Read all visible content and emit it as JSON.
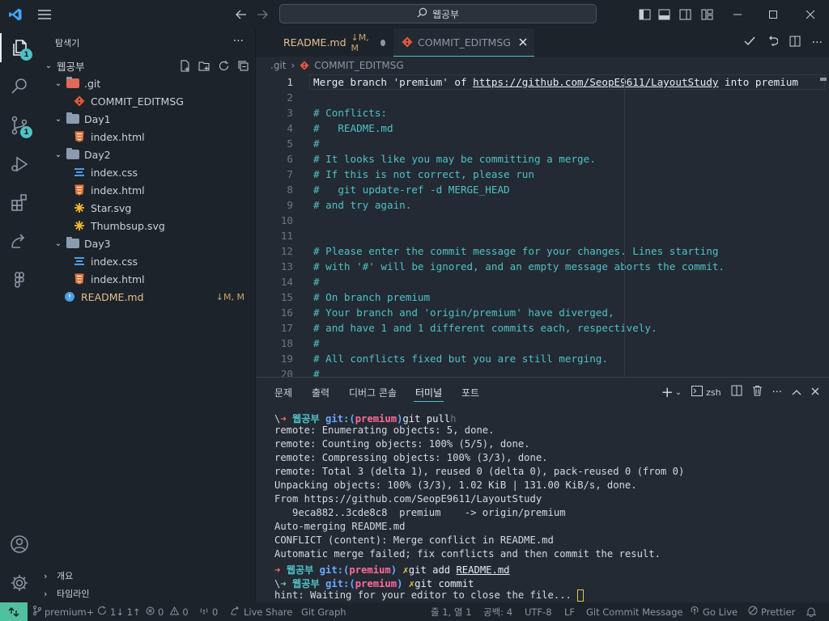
{
  "titlebar": {
    "search_text": "웹공부"
  },
  "activity": {
    "explorer_badge": "1",
    "scm_badge": "1"
  },
  "sidebar": {
    "title": "탐색기",
    "more": "···",
    "workspace": "웹공부",
    "tree": [
      {
        "label": ".git",
        "indent": 1,
        "kind": "folder-git"
      },
      {
        "label": "COMMIT_EDITMSG",
        "indent": 2,
        "kind": "git"
      },
      {
        "label": "Day1",
        "indent": 1,
        "kind": "folder"
      },
      {
        "label": "index.html",
        "indent": 2,
        "kind": "html"
      },
      {
        "label": "Day2",
        "indent": 1,
        "kind": "folder"
      },
      {
        "label": "index.css",
        "indent": 2,
        "kind": "css"
      },
      {
        "label": "index.html",
        "indent": 2,
        "kind": "html"
      },
      {
        "label": "Star.svg",
        "indent": 2,
        "kind": "svg"
      },
      {
        "label": "Thumbsup.svg",
        "indent": 2,
        "kind": "svg"
      },
      {
        "label": "Day3",
        "indent": 1,
        "kind": "folder"
      },
      {
        "label": "index.css",
        "indent": 2,
        "kind": "css"
      },
      {
        "label": "index.html",
        "indent": 2,
        "kind": "html"
      },
      {
        "label": "README.md",
        "indent": 1,
        "kind": "md"
      }
    ],
    "readme_badge": "↓M, M",
    "outline_label": "개요",
    "timeline_label": "타임라인"
  },
  "tabs": [
    {
      "label": "README.md",
      "badge": "↓M, M",
      "active": false
    },
    {
      "label": "COMMIT_EDITMSG",
      "active": true
    }
  ],
  "breadcrumb": {
    "folder": ".git",
    "file": "COMMIT_EDITMSG"
  },
  "editor": {
    "lines": [
      {
        "n": "1",
        "text": "Merge branch 'premium' of ",
        "url": "https://github.com/SeopE9611/LayoutStudy",
        "tail": " into premium"
      },
      {
        "n": "2",
        "text": ""
      },
      {
        "n": "3",
        "text": "# Conflicts:"
      },
      {
        "n": "4",
        "text": "#   README.md"
      },
      {
        "n": "5",
        "text": "#"
      },
      {
        "n": "6",
        "text": "# It looks like you may be committing a merge."
      },
      {
        "n": "7",
        "text": "# If this is not correct, please run"
      },
      {
        "n": "8",
        "text": "#   git update-ref -d MERGE_HEAD"
      },
      {
        "n": "9",
        "text": "# and try again."
      },
      {
        "n": "10",
        "text": ""
      },
      {
        "n": "11",
        "text": ""
      },
      {
        "n": "12",
        "text": "# Please enter the commit message for your changes. Lines starting"
      },
      {
        "n": "13",
        "text": "# with '#' will be ignored, and an empty message aborts the commit."
      },
      {
        "n": "14",
        "text": "#"
      },
      {
        "n": "15",
        "text": "# On branch premium"
      },
      {
        "n": "16",
        "text": "# Your branch and 'origin/premium' have diverged,"
      },
      {
        "n": "17",
        "text": "# and have 1 and 1 different commits each, respectively."
      },
      {
        "n": "18",
        "text": "#"
      },
      {
        "n": "19",
        "text": "# All conflicts fixed but you are still merging."
      },
      {
        "n": "20",
        "text": "#"
      }
    ]
  },
  "panel": {
    "tabs": [
      "문제",
      "출력",
      "디버그 콘솔",
      "터미널",
      "포트"
    ],
    "active_tab": "터미널",
    "shell": "zsh",
    "terminal": {
      "prompt1": {
        "arrow": "➜",
        "dir": "웹공부",
        "git": "git:(",
        "branch": "premium",
        "close": ")",
        "cmd": "git pull",
        "ghost": "h"
      },
      "output": [
        "remote: Enumerating objects: 5, done.",
        "remote: Counting objects: 100% (5/5), done.",
        "remote: Compressing objects: 100% (3/3), done.",
        "remote: Total 3 (delta 1), reused 0 (delta 0), pack-reused 0 (from 0)",
        "Unpacking objects: 100% (3/3), 1.02 KiB | 131.00 KiB/s, done.",
        "From https://github.com/SeopE9611/LayoutStudy",
        "   9eca882..3cde8c8  premium    -> origin/premium",
        "Auto-merging README.md",
        "CONFLICT (content): Merge conflict in README.md",
        "Automatic merge failed; fix conflicts and then commit the result."
      ],
      "prompt2": {
        "arrow": "➜",
        "dir": "웹공부",
        "git": "git:(",
        "branch": "premium",
        "close": ")",
        "x": "✗",
        "cmd": "git add ",
        "file": "README.md"
      },
      "prompt3": {
        "arrow": "➜",
        "dir": "웹공부",
        "git": "git:(",
        "branch": "premium",
        "close": ")",
        "x": "✗",
        "cmd": "git commit"
      },
      "hint": "hint: Waiting for your editor to close the file... "
    }
  },
  "statusbar": {
    "branch": "premium+",
    "sync": "1↓ 1↑",
    "errors": "0",
    "warnings": "0",
    "ports": "0",
    "live_share": "Live Share",
    "git_graph": "Git Graph",
    "position": "줄 1, 열 1",
    "spaces": "공백: 4",
    "encoding": "UTF-8",
    "eol": "LF",
    "language": "Git Commit Message",
    "go_live": "Go Live",
    "prettier": "Prettier"
  },
  "colors": {
    "accent": "#4fc1c6",
    "background": "#232a33",
    "sidebar": "#1d232a",
    "remote": "#4fc1a0"
  }
}
